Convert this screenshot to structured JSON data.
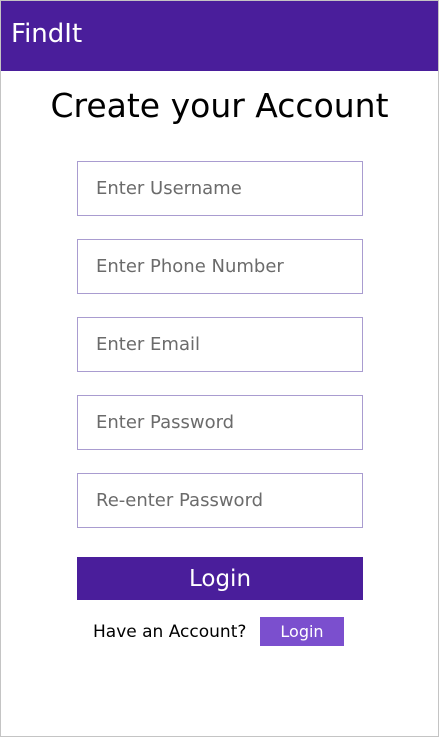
{
  "app_bar": {
    "title": "FindIt",
    "background_color": "#4a1e9b"
  },
  "form": {
    "title": "Create your Account",
    "fields": [
      {
        "placeholder": "Enter Username",
        "value": ""
      },
      {
        "placeholder": "Enter Phone Number",
        "value": ""
      },
      {
        "placeholder": "Enter Email",
        "value": ""
      },
      {
        "placeholder": "Enter Password",
        "value": ""
      },
      {
        "placeholder": "Re-enter Password",
        "value": ""
      }
    ],
    "submit_label": "Login",
    "submit_color": "#4a1e9b"
  },
  "footer": {
    "prompt_text": "Have an Account?",
    "login_label": "Login",
    "login_color": "#7b4fce"
  }
}
